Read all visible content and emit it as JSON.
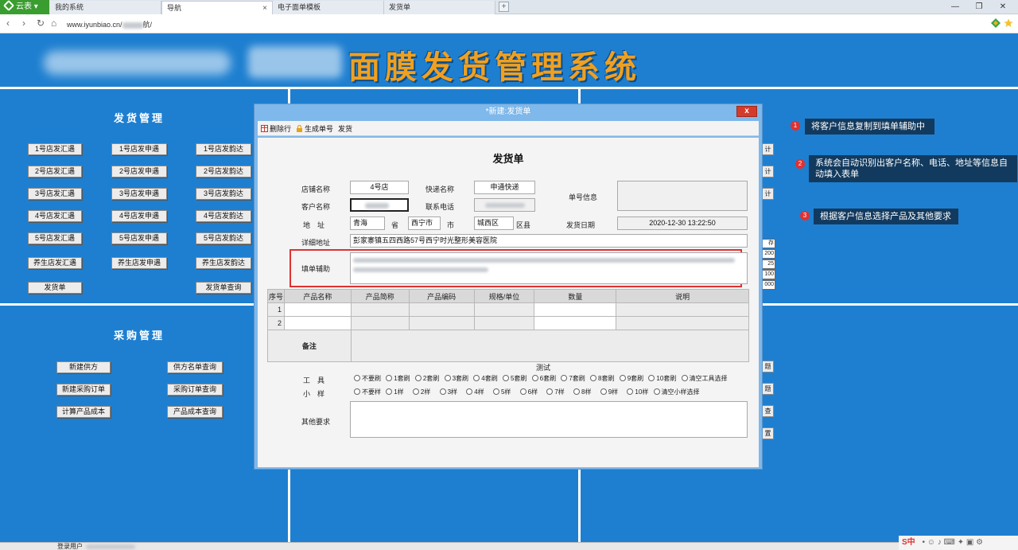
{
  "browser": {
    "brand": "云表",
    "tabs": [
      {
        "label": "我的系统"
      },
      {
        "label": "导航",
        "close": "×"
      },
      {
        "label": "电子面单模板"
      },
      {
        "label": "发货单"
      }
    ],
    "add_tab": "+",
    "window": {
      "min": "—",
      "restore": "❐",
      "close": "✕"
    },
    "url_prefix": "www.iyunbiao.cn/",
    "url_suffix": "航/"
  },
  "app": {
    "title": "面膜发货管理系统",
    "shipping_section": {
      "title": "发货管理",
      "col1": [
        "1号店发汇遇",
        "2号店发汇遇",
        "3号店发汇遇",
        "4号店发汇遇",
        "5号店发汇遇",
        "养生店发汇遇",
        "发货单"
      ],
      "col2": [
        "1号店发申遇",
        "2号店发申遇",
        "3号店发申遇",
        "4号店发申遇",
        "5号店发申遇",
        "养生店发申遇"
      ],
      "col3": [
        "1号店发韵达",
        "2号店发韵达",
        "3号店发韵达",
        "4号店发韵达",
        "5号店发韵达",
        "养生店发韵达",
        "发货单查询"
      ]
    },
    "purchase_section": {
      "title": "采购管理",
      "col1": [
        "新建供方",
        "新建采购订单",
        "计算产品成本"
      ],
      "col2": [
        "供方名单查询",
        "采购订单查询",
        "产品成本查询"
      ]
    },
    "right_edge": {
      "buttons": [
        "计",
        "计",
        "计"
      ],
      "cells": [
        "存",
        "200",
        "25",
        "100",
        "000"
      ],
      "lower": [
        "题",
        "题",
        "查",
        "置"
      ]
    },
    "login_label": "登录用户"
  },
  "dialog": {
    "title": "*新建:发货单",
    "close": "x",
    "toolbar": {
      "delete_row": "删除行",
      "generate_no": "生成单号",
      "ship": "发货"
    },
    "form_title": "发货单",
    "labels": {
      "store_name": "店铺名称",
      "express_name": "快递名称",
      "waybill_info": "单号信息",
      "customer_name": "客户名称",
      "contact_phone": "联系电话",
      "address": "地　址",
      "province": "省",
      "city": "市",
      "district": "区县",
      "ship_date": "发货日期",
      "detail_address": "详细地址",
      "fill_assist": "填单辅助",
      "remarks": "备注",
      "test": "测试",
      "tools": "工　具",
      "samples": "小　样",
      "other_requirements": "其他要求"
    },
    "values": {
      "store_name": "4号店",
      "express_name": "申通快递",
      "province": "青海",
      "city": "西宁市",
      "district": "城西区",
      "ship_date": "2020-12-30  13:22:50",
      "detail_address": "彭家寨镇五四西路57号西宁时光整形美容医院"
    },
    "table": {
      "headers": [
        "序号",
        "产品名称",
        "产品简称",
        "产品编码",
        "规格/单位",
        "数量",
        "说明"
      ],
      "rows": [
        {
          "no": "1"
        },
        {
          "no": "2"
        }
      ]
    },
    "tool_options": [
      "不要刷",
      "1套刷",
      "2套刷",
      "3套刷",
      "4套刷",
      "5套刷",
      "6套刷",
      "7套刷",
      "8套刷",
      "9套刷",
      "10套刷",
      "清空工具选择"
    ],
    "sample_options": [
      "不要样",
      "1样",
      "2样",
      "3样",
      "4样",
      "5样",
      "6样",
      "7样",
      "8样",
      "9样",
      "10样",
      "清空小样选择"
    ]
  },
  "annotations": [
    {
      "num": "1",
      "text": "将客户信息复制到填单辅助中"
    },
    {
      "num": "2",
      "text": "系统会自动识别出客户名称、电话、地址等信息自动填入表单"
    },
    {
      "num": "3",
      "text": "根据客户信息选择产品及其他要求"
    }
  ],
  "tray": {
    "ime": "S中"
  }
}
